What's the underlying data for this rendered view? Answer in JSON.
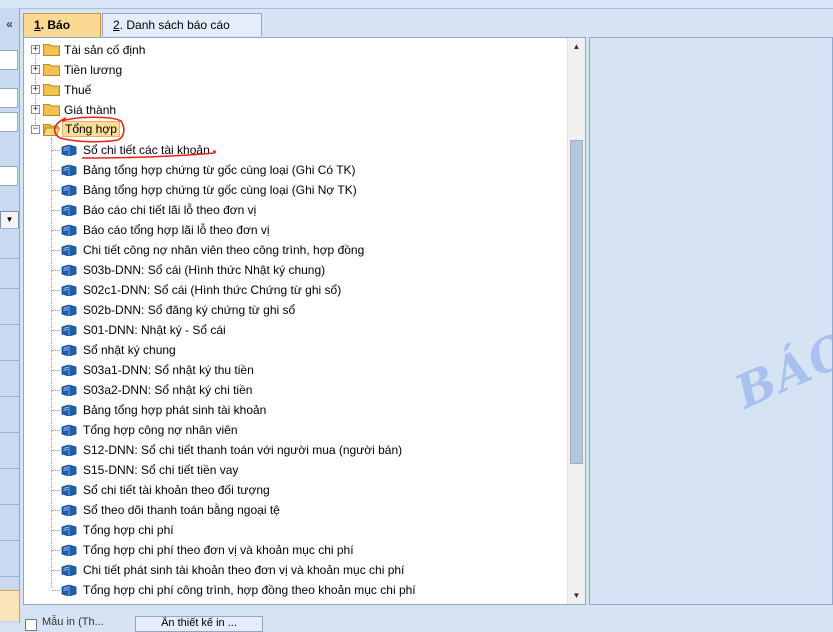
{
  "topbar": {
    "items": [
      "",
      ""
    ]
  },
  "leftpane": {
    "collapse_glyph": "«"
  },
  "tabs": [
    {
      "num": "1",
      "label": "Báo cáo"
    },
    {
      "num": "2",
      "label": "Danh sách báo cáo"
    }
  ],
  "folders": [
    {
      "label": "Tài sản cố định"
    },
    {
      "label": "Tiền lương"
    },
    {
      "label": "Thuế"
    },
    {
      "label": "Giá thành"
    },
    {
      "label": "Tổng hợp"
    }
  ],
  "reports": [
    {
      "label": "Sổ chi tiết các tài khoản"
    },
    {
      "label": "Bảng tổng hợp chứng từ gốc cùng loại (Ghi Có TK)"
    },
    {
      "label": "Bảng tổng hợp chứng từ gốc cùng loại (Ghi Nợ TK)"
    },
    {
      "label": "Báo cáo chi tiết lãi lỗ theo đơn vị"
    },
    {
      "label": "Báo cáo tổng hợp lãi lỗ theo đơn vị"
    },
    {
      "label": "Chi tiết công nợ nhân viên theo công trình, hợp đồng"
    },
    {
      "label": "S03b-DNN: Sổ cái (Hình thức Nhật ký chung)"
    },
    {
      "label": "S02c1-DNN: Sổ cái (Hình thức Chứng từ ghi sổ)"
    },
    {
      "label": "S02b-DNN: Sổ đăng ký chứng từ ghi sổ"
    },
    {
      "label": "S01-DNN: Nhật ký - Sổ cái"
    },
    {
      "label": "Sổ nhật ký chung"
    },
    {
      "label": "S03a1-DNN: Sổ nhật ký thu tiền"
    },
    {
      "label": "S03a2-DNN: Sổ nhật ký chi tiền"
    },
    {
      "label": "Bảng tổng hợp phát sinh tài khoản"
    },
    {
      "label": "Tổng hợp công nợ nhân viên"
    },
    {
      "label": "S12-DNN: Sổ chi tiết thanh toán với người mua (người bán)"
    },
    {
      "label": "S15-DNN: Sổ chi tiết tiền vay"
    },
    {
      "label": "Sổ chi tiết tài khoản theo đối tượng"
    },
    {
      "label": "Sổ theo dõi thanh toán bằng ngoại tệ"
    },
    {
      "label": "Tổng hợp chi phí"
    },
    {
      "label": "Tổng hợp chi phí theo đơn vị và khoản mục chi phí"
    },
    {
      "label": "Chi tiết phát sinh tài khoản theo đơn vị và khoản mục chi phí"
    },
    {
      "label": "Tổng hợp chi phí công trình, hợp đồng theo khoản mục chi phí"
    }
  ],
  "watermark": "BÁO",
  "bottombar": {
    "checkbox_label": "Mẫu in (Th...",
    "button_label": "Ẩn thiết kế in ..."
  },
  "colors": {
    "accent": "#fcd993",
    "annotation": "#e8231f",
    "book": "#1e5fae",
    "folder": "#f0c24f"
  }
}
